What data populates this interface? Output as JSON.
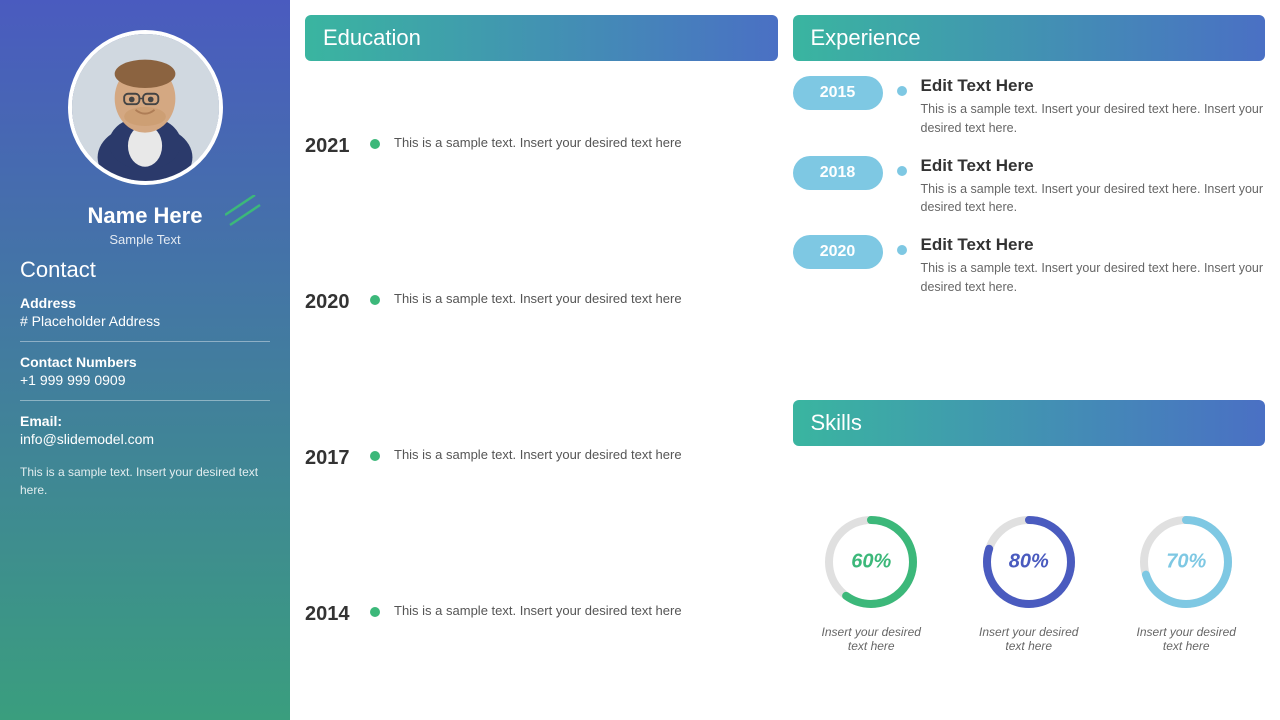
{
  "sidebar": {
    "name": "Name Here",
    "subtitle": "Sample Text",
    "contact_title": "Contact",
    "address_label": "Address",
    "address_value": "# Placeholder Address",
    "contact_label": "Contact Numbers",
    "contact_value": "+1 999 999 0909",
    "email_label": "Email:",
    "email_value": "info@slidemodel.com",
    "bottom_text": "This is a sample text. Insert your desired text here."
  },
  "education": {
    "header": "Education",
    "items": [
      {
        "year": "2021",
        "text": "This is a sample text. Insert your desired text here"
      },
      {
        "year": "2020",
        "text": "This is a sample text. Insert your desired text here"
      },
      {
        "year": "2017",
        "text": "This is a sample text. Insert your desired text here"
      },
      {
        "year": "2014",
        "text": "This is a sample text. Insert your desired text here"
      }
    ]
  },
  "experience": {
    "header": "Experience",
    "items": [
      {
        "year": "2015",
        "title": "Edit Text Here",
        "desc": "This is a sample text. Insert your desired text here. Insert your desired text here."
      },
      {
        "year": "2018",
        "title": "Edit Text Here",
        "desc": "This is a sample text. Insert your desired text here. Insert your desired text here."
      },
      {
        "year": "2020",
        "title": "Edit Text Here",
        "desc": "This is a sample text. Insert your desired text here. Insert your desired text here."
      }
    ]
  },
  "skills": {
    "header": "Skills",
    "items": [
      {
        "percent": 60,
        "label": "60%",
        "color": "#3cb87a",
        "desc": "Insert your desired\ntext here"
      },
      {
        "percent": 80,
        "label": "80%",
        "color": "#4a5bbf",
        "desc": "Insert your desired\ntext here"
      },
      {
        "percent": 70,
        "label": "70%",
        "color": "#7ec8e3",
        "desc": "Insert your desired\ntext here"
      }
    ]
  },
  "colors": {
    "sidebar_top": "#4a5bbf",
    "sidebar_bottom": "#3a9e7e",
    "accent_green": "#3cb87a",
    "accent_blue": "#4a5bbf",
    "accent_light_blue": "#7ec8e3"
  }
}
